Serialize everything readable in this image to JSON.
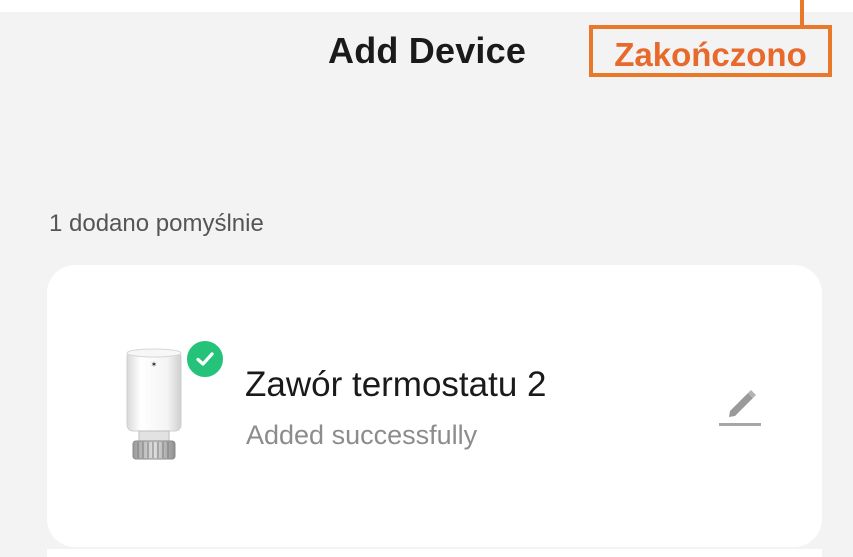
{
  "header": {
    "title": "Add Device",
    "done_label": "Zakończono"
  },
  "section": {
    "added_count_label": "1 dodano pomyślnie"
  },
  "device": {
    "name": "Zawór termostatu 2",
    "status": "Added successfully",
    "image_icon": "radiator-thermostat-valve",
    "badge_icon": "check-circle-icon",
    "edit_icon": "pencil-icon"
  },
  "colors": {
    "accent": "#e8692c",
    "highlight_border": "#e8792a",
    "success": "#25c27a",
    "background": "#f3f3f3",
    "card": "#ffffff"
  }
}
